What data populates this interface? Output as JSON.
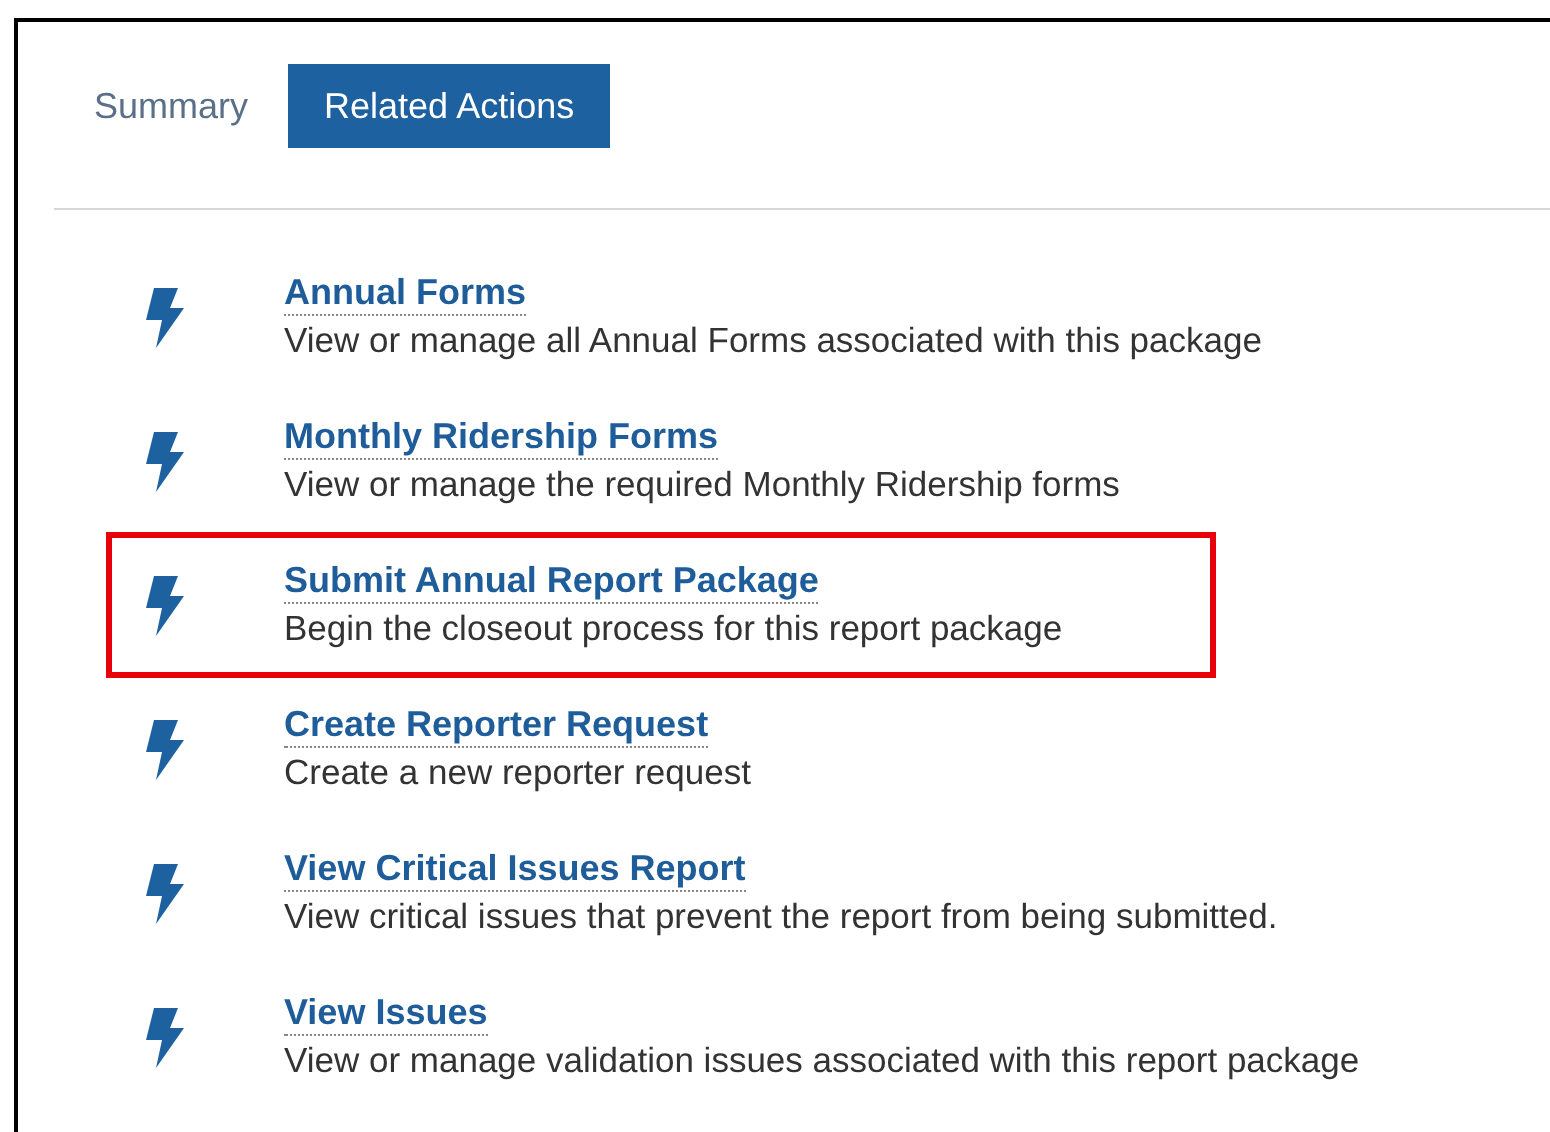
{
  "tabs": [
    {
      "label": "Summary",
      "selected": false
    },
    {
      "label": "Related Actions",
      "selected": true
    }
  ],
  "actions": [
    {
      "title": "Annual Forms",
      "description": "View or manage all Annual Forms associated with this package",
      "highlighted": false
    },
    {
      "title": "Monthly Ridership Forms",
      "description": "View or manage the required Monthly Ridership forms",
      "highlighted": false
    },
    {
      "title": "Submit Annual Report Package",
      "description": "Begin the closeout process for this report package",
      "highlighted": true
    },
    {
      "title": "Create Reporter Request",
      "description": "Create a new reporter request",
      "highlighted": false
    },
    {
      "title": "View Critical Issues Report",
      "description": "View critical issues that prevent the report from being submitted.",
      "highlighted": false
    },
    {
      "title": "View Issues",
      "description": "View or manage validation issues associated with this report package",
      "highlighted": false
    }
  ]
}
